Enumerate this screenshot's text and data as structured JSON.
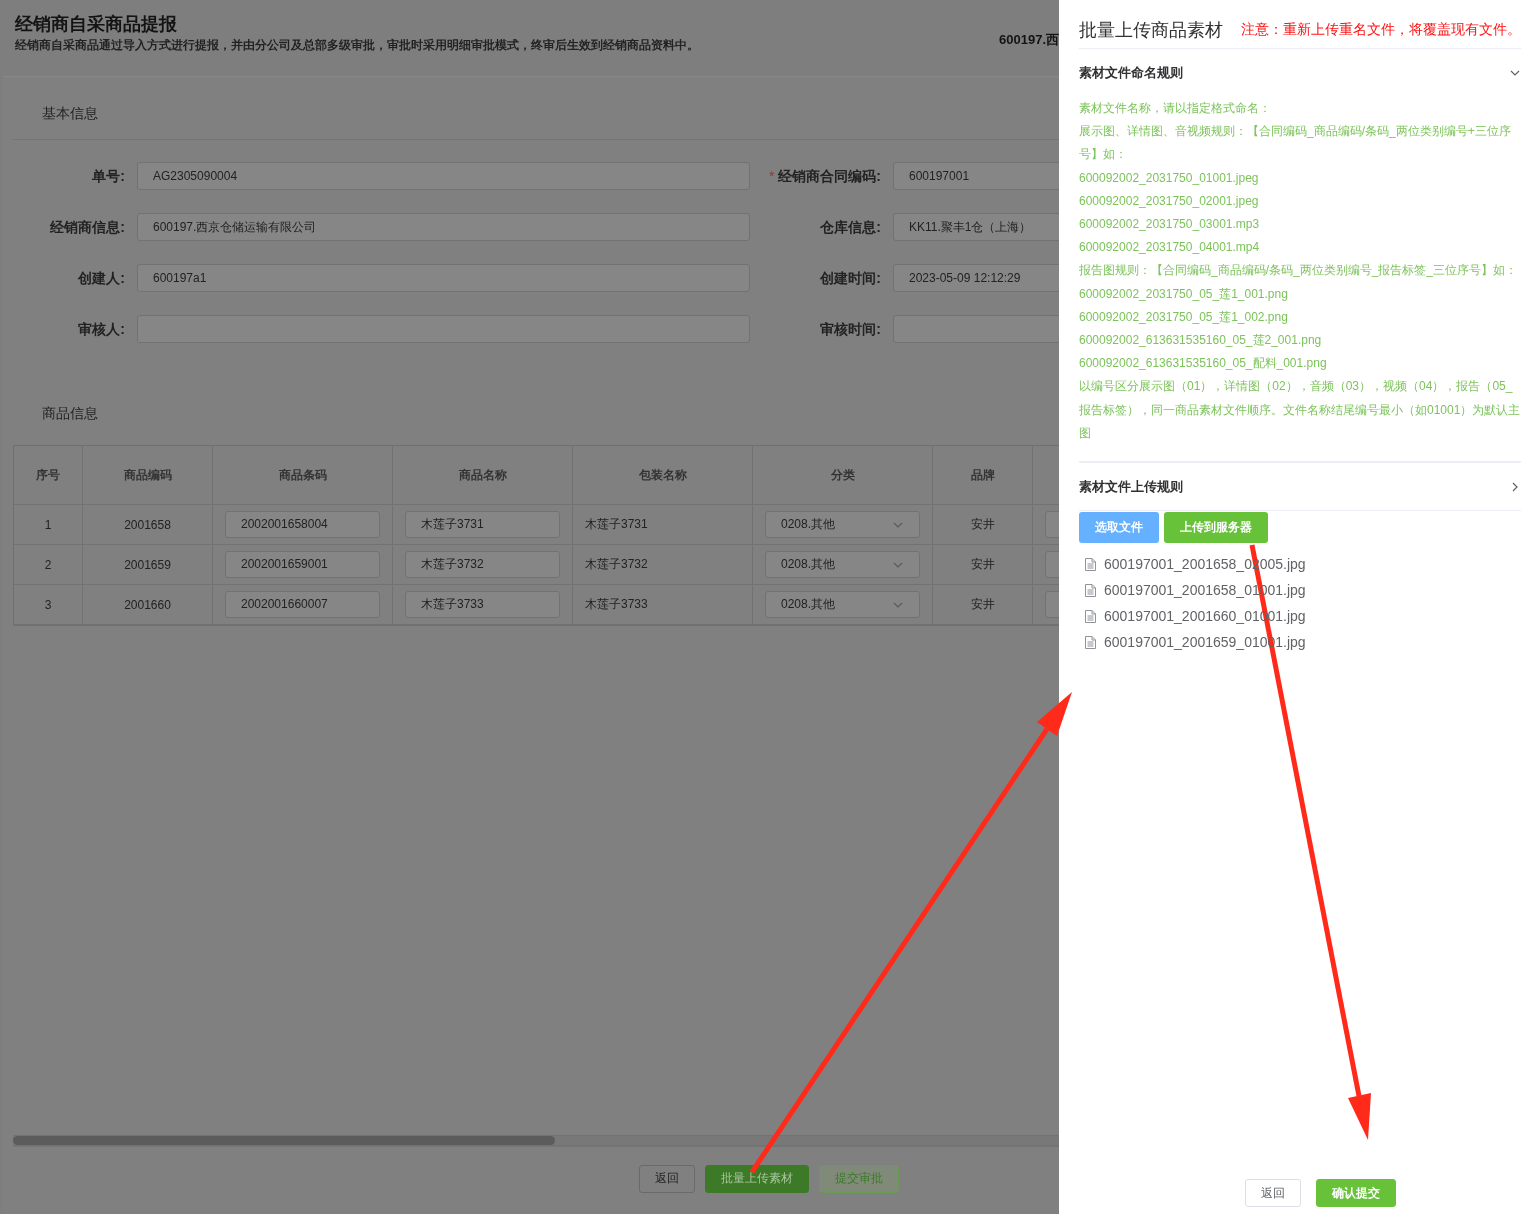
{
  "page": {
    "title": "经销商自采商品提报",
    "subtitle": "经销商自采商品通过导入方式进行提报，并由分公司及总部多级审批，审批时采用明细审批模式，终审后生效到经销商品资料中。",
    "header_right": "600197.西"
  },
  "basic_info": {
    "heading": "基本信息",
    "fields": [
      {
        "label": "单号:",
        "value": "AG2305090004"
      },
      {
        "label": "经销商合同编码:",
        "value": "600197001",
        "mark": "*"
      },
      {
        "label": "经销商信息:",
        "value": "600197.西京仓储运输有限公司"
      },
      {
        "label": "仓库信息:",
        "value": "KK11.聚丰1仓（上海）"
      },
      {
        "label": "创建人:",
        "value": "600197a1"
      },
      {
        "label": "创建时间:",
        "value": "2023-05-09 12:12:29"
      },
      {
        "label": "审核人:"
      },
      {
        "label": "审核时间:"
      }
    ]
  },
  "goods_info": {
    "heading": "商品信息",
    "columns": [
      {
        "label": "序号",
        "kind": "text"
      },
      {
        "label": "商品编码",
        "kind": "text"
      },
      {
        "label": "商品条码",
        "kind": "input"
      },
      {
        "label": "商品名称",
        "kind": "input"
      },
      {
        "label": "包装名称",
        "kind": "plain"
      },
      {
        "label": "分类",
        "kind": "select"
      },
      {
        "label": "品牌",
        "kind": "text"
      }
    ],
    "rows": [
      [
        "1",
        "2001658",
        "2002001658004",
        "木莲子3731",
        "木莲子3731",
        "0208.其他",
        "安井"
      ],
      [
        "2",
        "2001659",
        "2002001659001",
        "木莲子3732",
        "木莲子3732",
        "0208.其他",
        "安井"
      ],
      [
        "3",
        "2001660",
        "2002001660007",
        "木莲子3733",
        "木莲子3733",
        "0208.其他",
        "安井"
      ]
    ]
  },
  "footer_buttons": [
    {
      "label": "返回",
      "kind": "default"
    },
    {
      "label": "批量上传素材",
      "kind": "primary"
    },
    {
      "label": "提交审批",
      "kind": "plain"
    }
  ],
  "drawer": {
    "title": "批量上传商品素材",
    "notice": "注意：重新上传重名文件，将覆盖现有文件。",
    "sections": [
      {
        "title": "素材文件命名规则",
        "expanded": true,
        "lines": [
          "素材文件名称，请以指定格式命名：",
          "展示图、详情图、音视频规则：【合同编码_商品编码/条码_两位类别编号+三位序号】如：",
          "600092002_2031750_01001.jpeg",
          "600092002_2031750_02001.jpeg",
          "600092002_2031750_03001.mp3",
          "600092002_2031750_04001.mp4",
          "报告图规则：【合同编码_商品编码/条码_两位类别编号_报告标签_三位序号】如：",
          "600092002_2031750_05_莲1_001.png",
          "600092002_2031750_05_莲1_002.png",
          "600092002_613631535160_05_莲2_001.png",
          "600092002_613631535160_05_配料_001.png",
          "以编号区分展示图（01），详情图（02），音频（03），视频（04），报告（05_报告标签），同一商品素材文件顺序。文件名称结尾编号最小（如01001）为默认主图"
        ]
      },
      {
        "title": "素材文件上传规则",
        "expanded": false
      }
    ],
    "buttons": [
      {
        "label": "选取文件",
        "kind": "select"
      },
      {
        "label": "上传到服务器",
        "kind": "upload"
      }
    ],
    "files": [
      "600197001_2001658_02005.jpg",
      "600197001_2001658_01001.jpg",
      "600197001_2001660_01001.jpg",
      "600197001_2001659_01001.jpg"
    ],
    "footer_buttons": [
      {
        "label": "返回",
        "kind": "default"
      },
      {
        "label": "确认提交",
        "kind": "primary"
      }
    ]
  }
}
